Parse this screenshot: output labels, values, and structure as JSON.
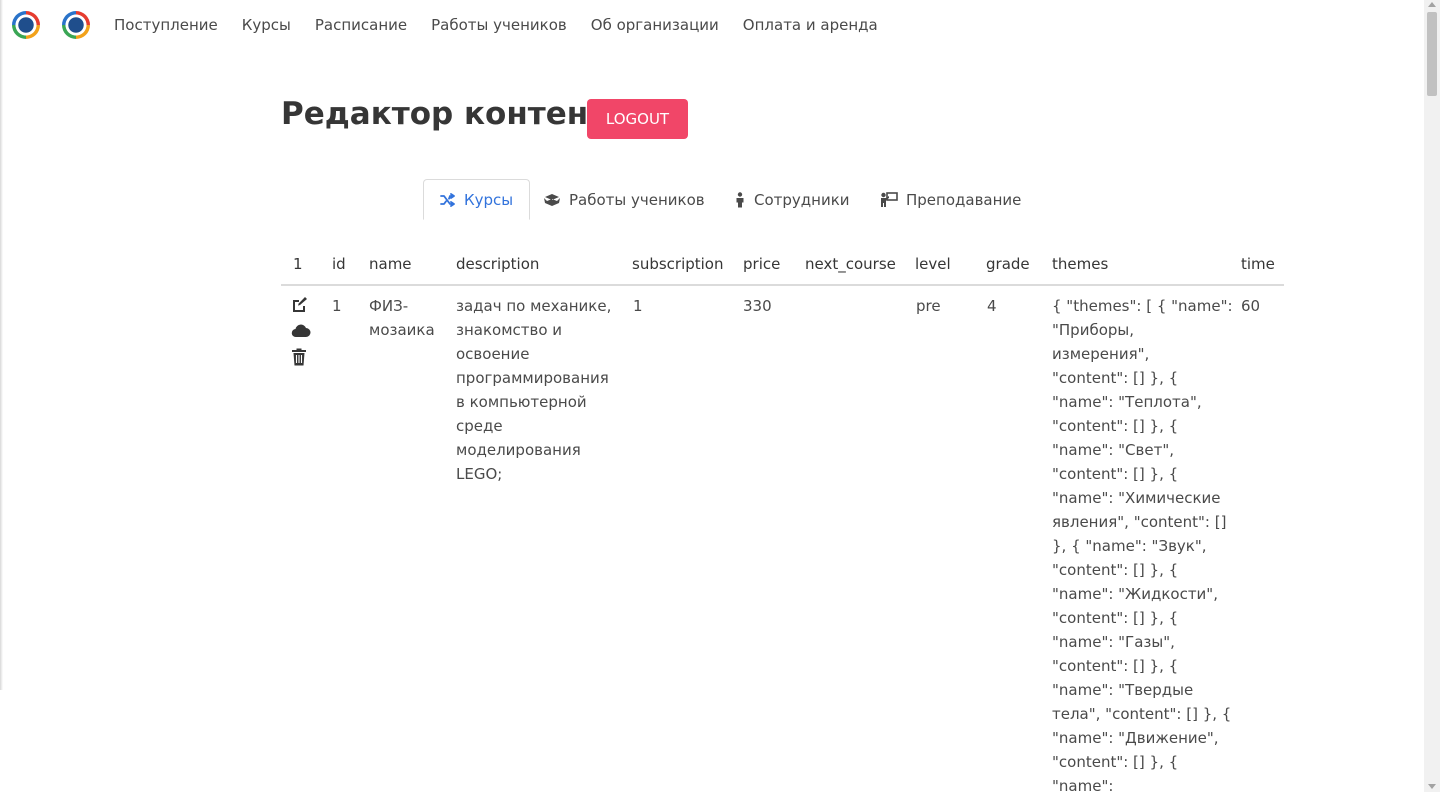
{
  "nav": {
    "items": [
      "Поступление",
      "Курсы",
      "Расписание",
      "Работы учеников",
      "Об организации",
      "Оплата и аренда"
    ]
  },
  "header": {
    "title": "Редактор контента",
    "logout": "LOGOUT"
  },
  "tabs": [
    {
      "label": "Курсы",
      "icon": "shuffle-icon",
      "active": true
    },
    {
      "label": "Работы учеников",
      "icon": "box-open-icon",
      "active": false
    },
    {
      "label": "Сотрудники",
      "icon": "person-icon",
      "active": false
    },
    {
      "label": "Преподавание",
      "icon": "teacher-icon",
      "active": false
    }
  ],
  "table": {
    "columns": [
      "1",
      "id",
      "name",
      "description",
      "subscription",
      "price",
      "next_course",
      "level",
      "grade",
      "themes",
      "time"
    ],
    "row": {
      "id": "1",
      "name": [
        "ФИЗ-",
        "мозаика"
      ],
      "description": [
        "задач по механике,",
        "знакомство и",
        "освоение",
        "программирования",
        "в компьютерной",
        "среде",
        "моделирования",
        "LEGO;"
      ],
      "subscription": "1",
      "price": "330",
      "next_course": "",
      "level": "pre",
      "grade": "4",
      "themes": [
        "{ \"themes\": [ { \"name\":",
        "\"Приборы,",
        "измерения\",",
        "\"content\": [] }, {",
        "\"name\": \"Теплота\",",
        "\"content\": [] }, {",
        "\"name\": \"Свет\",",
        "\"content\": [] }, {",
        "\"name\": \"Химические",
        "явления\", \"content\": []",
        "}, { \"name\": \"Звук\",",
        "\"content\": [] }, {",
        "\"name\": \"Жидкости\",",
        "\"content\": [] }, {",
        "\"name\": \"Газы\",",
        "\"content\": [] }, {",
        "\"name\": \"Твердые",
        "тела\", \"content\": [] }, {",
        "\"name\": \"Движение\",",
        "\"content\": [] }, {",
        "\"name\":"
      ],
      "time": "60"
    },
    "actions": [
      "edit-icon",
      "cloud-icon",
      "trash-icon"
    ]
  },
  "colors": {
    "logout_bg": "#f14668",
    "active_tab": "#3273dc",
    "text": "#363636"
  }
}
